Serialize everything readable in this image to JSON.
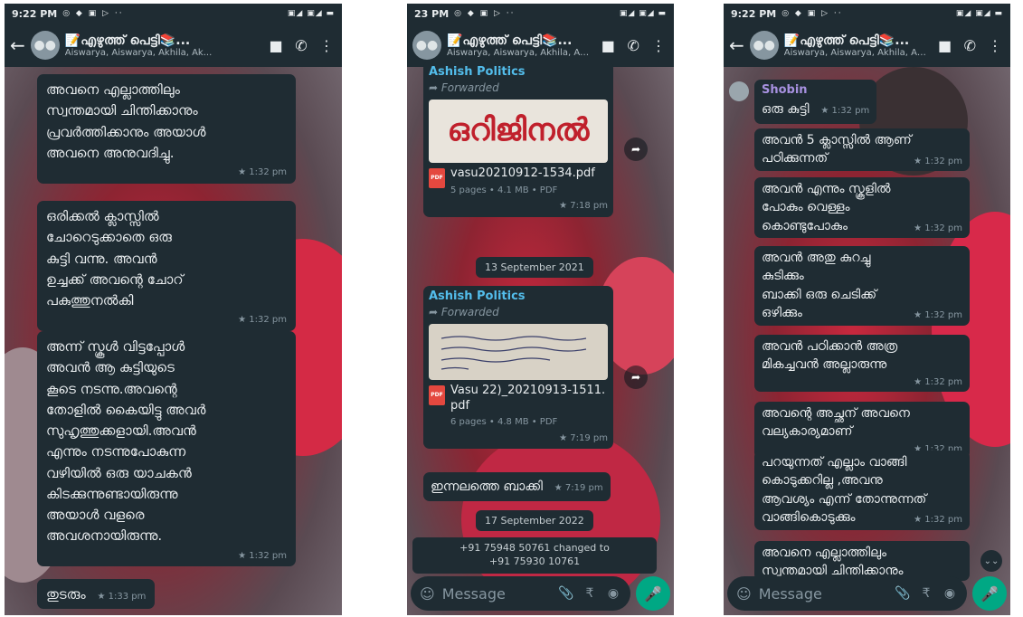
{
  "status": {
    "time_1": "9:22 PM",
    "time_2": "23 PM",
    "time_3": "9:22 PM"
  },
  "chat": {
    "title": "📝എഴുത്ത് പെട്ടി📚...",
    "subtitle": "Aiswarya, Aiswarya, Akhila, Ak...",
    "back_icon": "←",
    "video_icon": "■",
    "call_icon": "✆",
    "menu_icon": "⋮"
  },
  "phone1": {
    "messages": [
      {
        "text": "അവനെ എല്ലാത്തിലും\nസ്വന്തമായി ചിന്തിക്കാനും\nപ്രവർത്തിക്കാനും അയാൾ\nഅവനെ അനുവദിച്ചു.",
        "time": "★ 1:32 pm"
      },
      {
        "text": "ഒരിക്കൽ ക്ലാസ്സിൽ\nചോറെടുക്കാതെ ഒരു\nകുട്ടി വന്നു. അവൻ\nഉച്ചക്ക് അവന്റെ ചോറ്\nപകുത്തുനൽകി",
        "time": "★ 1:32 pm"
      },
      {
        "text": "അന്ന് സ്കൂൾ വിട്ടപ്പോൾ\nഅവൻ ആ കുട്ടിയുടെ\nകൂടെ നടന്നു.അവന്റെ\nതോളിൽ കൈയിട്ടു അവർ\nസുഹൃത്തുക്കളായി.അവൻ\nഎന്നും നടന്നുപോകുന്ന\nവഴിയിൽ ഒരു യാചകൻ\nകിടക്കുന്നുണ്ടായിരുന്നു\nഅയാൾ വളരെ\nഅവശനായിരുന്നു.",
        "time": "★ 1:32 pm"
      },
      {
        "text": "തുടരും",
        "time": "★ 1:33 pm"
      }
    ]
  },
  "phone2": {
    "doc1": {
      "sender": "Ashish Politics",
      "forwarded": "Forwarded",
      "thumb_word": "ഒറിജിനൽ",
      "filename": "vasu20210912-1534.pdf",
      "info": "5 pages • 4.1 MB • PDF",
      "time": "★ 7:18 pm"
    },
    "date1": "13 September 2021",
    "doc2": {
      "sender": "Ashish Politics",
      "forwarded": "Forwarded",
      "filename": "Vasu 22)_20210913-1511.pdf",
      "info": "6 pages • 4.8 MB • PDF",
      "time": "★ 7:19 pm"
    },
    "msg": {
      "text": "ഇന്നലത്തെ ബാക്കി",
      "time": "★ 7:19 pm"
    },
    "date2": "17 September 2022",
    "system": "+91 75948 50761 changed to\n+91 75930 10761",
    "input_placeholder": "Message"
  },
  "phone3": {
    "sender": "Shobin",
    "messages": [
      {
        "text": "ഒരു കുട്ടി",
        "time": "★ 1:32 pm"
      },
      {
        "text": "അവൻ 5 ക്ലാസ്സിൽ ആണ്\nപഠിക്കുന്നത്",
        "time": "★ 1:32 pm"
      },
      {
        "text": "അവൻ എന്നും സ്കൂളിൽ\nപോകും വെള്ളം\nകൊണ്ടുപോകും",
        "time": "★ 1:32 pm"
      },
      {
        "text": "അവൻ അതു കുറച്ചു\nകുടിക്കും\n  ബാക്കി ഒരു ചെടിക്ക്\nഒഴിക്കും",
        "time": "★ 1:32 pm"
      },
      {
        "text": "അവൻ പഠിക്കാൻ അത്ര\nമികച്ചവൻ അല്ലാരുന്നു",
        "time": "★ 1:32 pm"
      },
      {
        "text": "അവന്റെ അച്ഛന് അവനെ\nവല്യകാര്യമാണ്",
        "time": "★ 1:32 pm"
      },
      {
        "text": "പറയുന്നത് എല്ലാം വാങ്ങി\nകൊടുക്കറില്ല ,അവനു\nആവശ്യം എന്ന് തോന്നുന്നത്\nവാങ്ങികൊടുക്കും",
        "time": "★ 1:32 pm"
      },
      {
        "text": "അവനെ എല്ലാത്തിലും\nസ്വന്തമായി ചിന്തിക്കാനും",
        "time": ""
      }
    ],
    "input_placeholder": "Message"
  },
  "icons": {
    "mic": "🎤",
    "attach": "📎",
    "rupee": "₹",
    "camera": "◉",
    "emoji": "☺",
    "share": "➦",
    "forward": "➦",
    "scroll_down": "⌄⌄"
  }
}
